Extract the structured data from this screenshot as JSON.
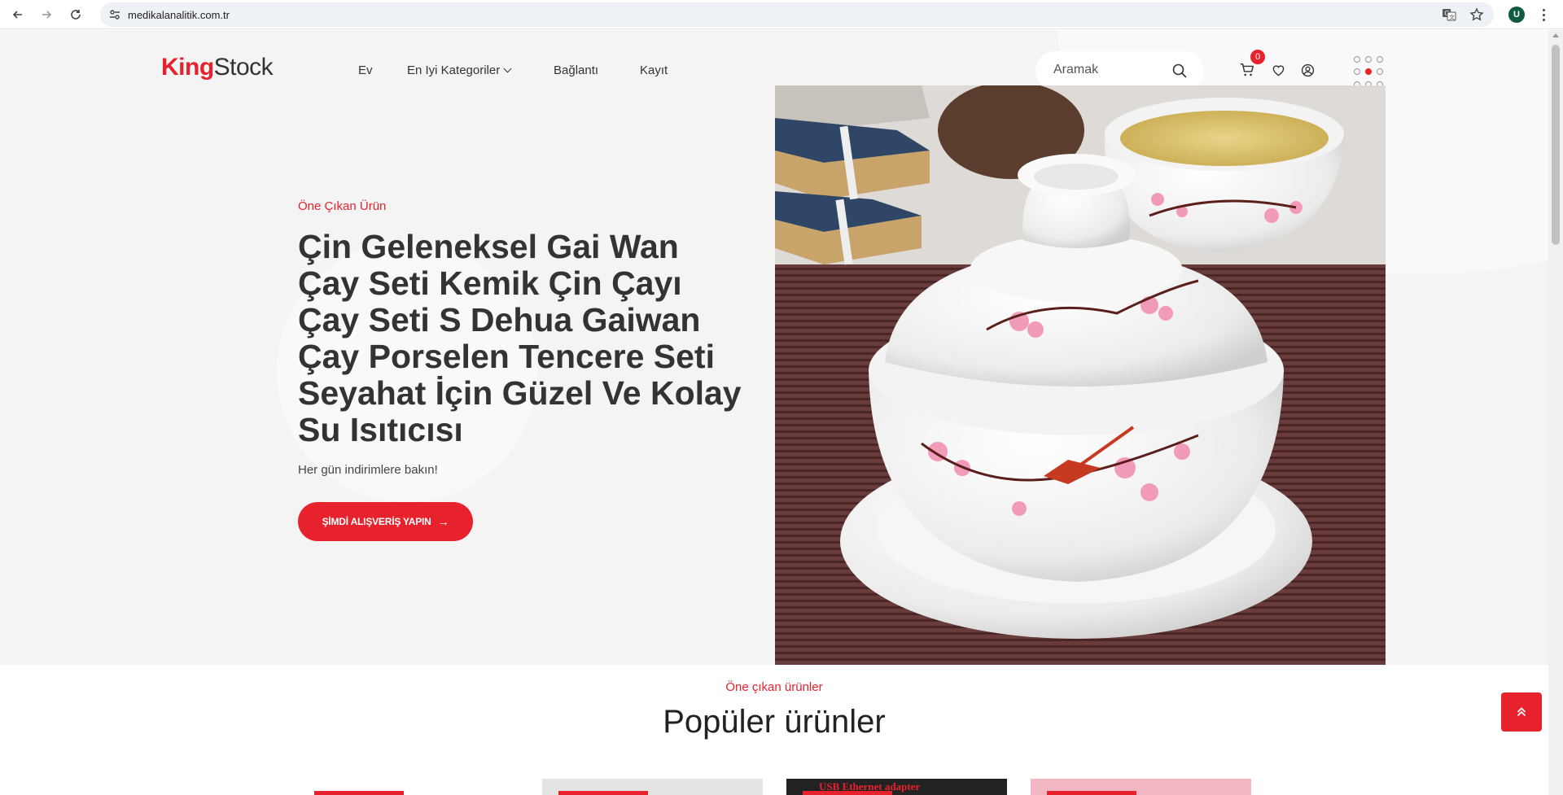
{
  "browser": {
    "url": "medikalanalitik.com.tr",
    "profile_initial": "U"
  },
  "header": {
    "logo_part1": "King",
    "logo_part2": "Stock",
    "nav": [
      {
        "label": "Ev"
      },
      {
        "label": "En Iyi Kategoriler"
      },
      {
        "label": "Bağlantı"
      },
      {
        "label": "Kayıt"
      }
    ],
    "search_placeholder": "Aramak",
    "cart_count": "0"
  },
  "hero": {
    "tag": "Öne Çıkan Ürün",
    "title_lines": [
      "Çin Geleneksel Gai Wan",
      "Çay Seti Kemik Çin Çayı",
      "Çay Seti S Dehua Gaiwan",
      "Çay Porselen Tencere Seti",
      "Seyahat İçin Güzel Ve Kolay",
      "Su Isıtıcısı"
    ],
    "subtitle": "Her gün indirimlere bakın!",
    "cta_label": "ŞİMDİ ALIŞVERİŞ YAPIN"
  },
  "section": {
    "tag": "Öne çıkan ürünler",
    "title": "Popüler ürünler"
  },
  "cards": [
    {
      "image_caption": ""
    },
    {
      "image_caption": ""
    },
    {
      "image_caption": "USB Ethernet adapter"
    },
    {
      "image_caption": ""
    }
  ],
  "colors": {
    "accent": "#e8222d",
    "hero_bg": "#f4f4f4",
    "text": "#333333"
  },
  "icons": {
    "back": "arrow-left-icon",
    "forward": "arrow-right-icon",
    "reload": "reload-icon",
    "translate": "translate-icon",
    "bookmark": "star-icon",
    "menu": "kebab-menu-icon",
    "search": "search-icon",
    "cart": "cart-icon",
    "wishlist": "heart-icon",
    "account": "user-circle-icon",
    "apps": "dots-grid-icon",
    "to_top": "double-chevron-up-icon"
  }
}
